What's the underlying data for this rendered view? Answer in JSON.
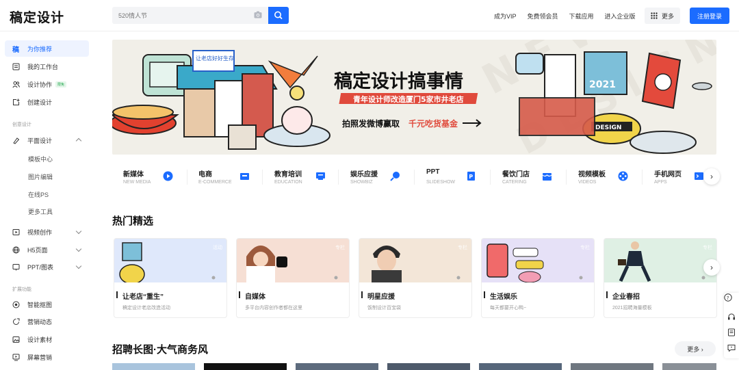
{
  "header": {
    "logo": "稿定设计",
    "search_placeholder": "520情人节",
    "nav": [
      "成为VIP",
      "免费领会员",
      "下载应用",
      "进入企业版"
    ],
    "more_label": "更多",
    "register_label": "注册登录"
  },
  "sidebar": {
    "main_items": [
      {
        "label": "为你推荐",
        "icon": "logo-icon"
      },
      {
        "label": "我的工作台",
        "icon": "workspace-icon"
      },
      {
        "label": "设计协作",
        "icon": "team-icon",
        "badge": "限免"
      },
      {
        "label": "创建设计",
        "icon": "create-icon"
      }
    ],
    "section_design": "创意设计",
    "graphic_label": "平面设计",
    "graphic_sub": [
      "模板中心",
      "图片编辑",
      "在线PS",
      "更多工具"
    ],
    "other_items": [
      {
        "label": "视频创作",
        "icon": "video-icon"
      },
      {
        "label": "H5页面",
        "icon": "globe-icon"
      },
      {
        "label": "PPT/图表",
        "icon": "ppt-icon"
      }
    ],
    "section_ext": "扩展功能",
    "ext_items": [
      {
        "label": "智能抠图",
        "icon": "cutout-icon"
      },
      {
        "label": "营销动态",
        "icon": "marketing-icon"
      },
      {
        "label": "设计素材",
        "icon": "material-icon"
      },
      {
        "label": "屏幕营销",
        "icon": "screen-icon"
      }
    ]
  },
  "banner": {
    "title": "稿定设计搞事情",
    "subtitle": "青年设计师改造厦门5家市井老店",
    "cta_prefix": "拍照发微博赢取",
    "cta_highlight": "千元吃货基金",
    "sign_text": "让老店好好生存",
    "year_text": "2021",
    "design_text": "DESIGN"
  },
  "categories": [
    {
      "title": "新媒体",
      "sub": "NEW MEDIA",
      "color": "#1b6cff"
    },
    {
      "title": "电商",
      "sub": "E-COMMERCE",
      "color": "#1b6cff"
    },
    {
      "title": "教育培训",
      "sub": "EDUCATION",
      "color": "#1b6cff"
    },
    {
      "title": "娱乐应援",
      "sub": "SHOWBIZ",
      "color": "#1b6cff"
    },
    {
      "title": "PPT",
      "sub": "SLIDESHOW",
      "color": "#1b6cff"
    },
    {
      "title": "餐饮门店",
      "sub": "CATERING",
      "color": "#1b6cff"
    },
    {
      "title": "视频模板",
      "sub": "VIDEOS",
      "color": "#1b6cff"
    },
    {
      "title": "手机网页",
      "sub": "APPS",
      "color": "#1b6cff"
    }
  ],
  "hot": {
    "heading": "热门精选",
    "cards": [
      {
        "tag": "活动",
        "title": "让老店“重生”",
        "desc": "稿定设计老店改造活动",
        "bg": "#dfe8fb"
      },
      {
        "tag": "专栏",
        "title": "自媒体",
        "desc": "多平台内容创作者都在这里",
        "bg": "#f6dfd4"
      },
      {
        "tag": "专栏",
        "title": "明星应援",
        "desc": "饭制设计百宝袋",
        "bg": "#f3e6d8"
      },
      {
        "tag": "专栏",
        "title": "生活娱乐",
        "desc": "每天都要开心鸭~",
        "bg": "#e6e1f7"
      },
      {
        "tag": "专栏",
        "title": "企业春招",
        "desc": "2021招聘海量模板",
        "bg": "#dff0e4"
      }
    ]
  },
  "recruit": {
    "heading": "招聘长图·大气商务风",
    "more_label": "更多 ›"
  }
}
